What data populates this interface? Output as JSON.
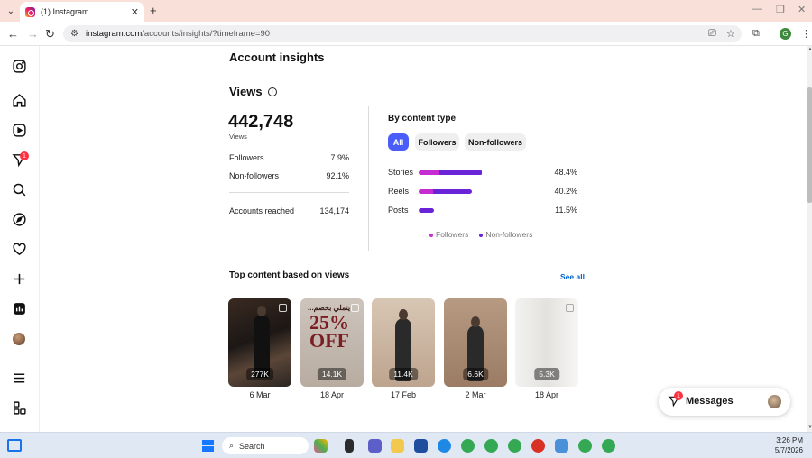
{
  "browser": {
    "tab_title": "(1) Instagram",
    "url_host": "instagram.com",
    "url_path": "/accounts/insights/?timeframe=90",
    "profile_initial": "G"
  },
  "sidebar": {
    "icons": [
      "instagram-icon",
      "home-icon",
      "reels-icon",
      "notifications-icon",
      "search-icon",
      "explore-icon",
      "heart-icon",
      "create-icon",
      "insights-icon",
      "profile-avatar",
      "menu-icon",
      "more-icon"
    ],
    "notification_count": "1"
  },
  "page": {
    "title": "Account insights"
  },
  "views": {
    "title": "Views",
    "total": "442,748",
    "total_label": "Views",
    "followers_label": "Followers",
    "followers_pct": "7.9%",
    "nonfollowers_label": "Non-followers",
    "nonfollowers_pct": "92.1%",
    "reached_label": "Accounts reached",
    "reached_value": "134,174"
  },
  "content_type": {
    "title": "By content type",
    "pills": [
      "All",
      "Followers",
      "Non-followers"
    ],
    "active_pill": "All",
    "legend": [
      "Followers",
      "Non-followers"
    ],
    "colors": {
      "followers": "#c52dd3",
      "non_followers": "#6a24d8",
      "accent": "#4a5df9"
    }
  },
  "chart_data": {
    "type": "bar",
    "categories": [
      "Stories",
      "Reels",
      "Posts"
    ],
    "labels": [
      "48.4%",
      "40.2%",
      "11.5%"
    ],
    "series": [
      {
        "name": "Followers",
        "values": [
          32,
          28,
          5
        ]
      },
      {
        "name": "Non-followers",
        "values": [
          68,
          72,
          95
        ]
      }
    ],
    "totals": [
      48.4,
      40.2,
      11.5
    ]
  },
  "top_content": {
    "title": "Top content based on views",
    "see_all": "See all",
    "items": [
      {
        "count": "277K",
        "date": "6 Mar"
      },
      {
        "count": "14.1K",
        "date": "18 Apr",
        "promo_line1": "...يتملي بخصم",
        "promo_line2": "25%",
        "promo_line3": "OFF"
      },
      {
        "count": "11.4K",
        "date": "17 Feb"
      },
      {
        "count": "6.6K",
        "date": "2 Mar"
      },
      {
        "count": "5.3K",
        "date": "18 Apr"
      }
    ]
  },
  "messages": {
    "label": "Messages",
    "badge": "1"
  },
  "taskbar": {
    "search_placeholder": "Search",
    "time": "3:26 PM",
    "date": "5/7/2026"
  }
}
